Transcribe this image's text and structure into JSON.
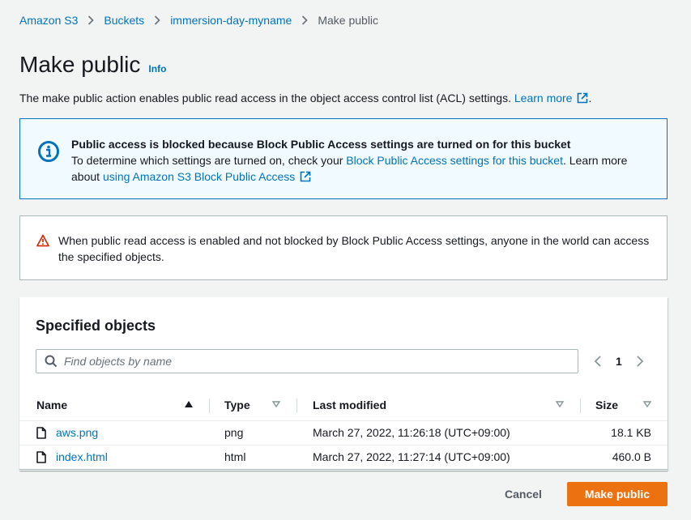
{
  "breadcrumb": {
    "items": [
      "Amazon S3",
      "Buckets",
      "immersion-day-myname"
    ],
    "current": "Make public"
  },
  "header": {
    "title": "Make public",
    "info_link": "Info",
    "description": "The make public action enables public read access in the object access control list (ACL) settings.",
    "learn_more": "Learn more"
  },
  "info_alert": {
    "title": "Public access is blocked because Block Public Access settings are turned on for this bucket",
    "text_before": "To determine which settings are turned on, check your ",
    "settings_link": "Block Public Access settings for this bucket",
    "text_middle": ". Learn more about ",
    "bpa_link": "using Amazon S3 Block Public Access"
  },
  "warning": {
    "text": "When public read access is enabled and not blocked by Block Public Access settings, anyone in the world can access the specified objects."
  },
  "objects_panel": {
    "title": "Specified objects",
    "search_placeholder": "Find objects by name",
    "page": "1",
    "columns": [
      "Name",
      "Type",
      "Last modified",
      "Size"
    ],
    "rows": [
      {
        "name": "aws.png",
        "type": "png",
        "modified": "March 27, 2022, 11:26:18 (UTC+09:00)",
        "size": "18.1 KB"
      },
      {
        "name": "index.html",
        "type": "html",
        "modified": "March 27, 2022, 11:27:14 (UTC+09:00)",
        "size": "460.0 B"
      }
    ]
  },
  "footer": {
    "cancel": "Cancel",
    "primary": "Make public"
  },
  "colors": {
    "link": "#0073bb",
    "primary": "#ec7211",
    "warning": "#d13212",
    "info_bg": "#f1faff"
  }
}
